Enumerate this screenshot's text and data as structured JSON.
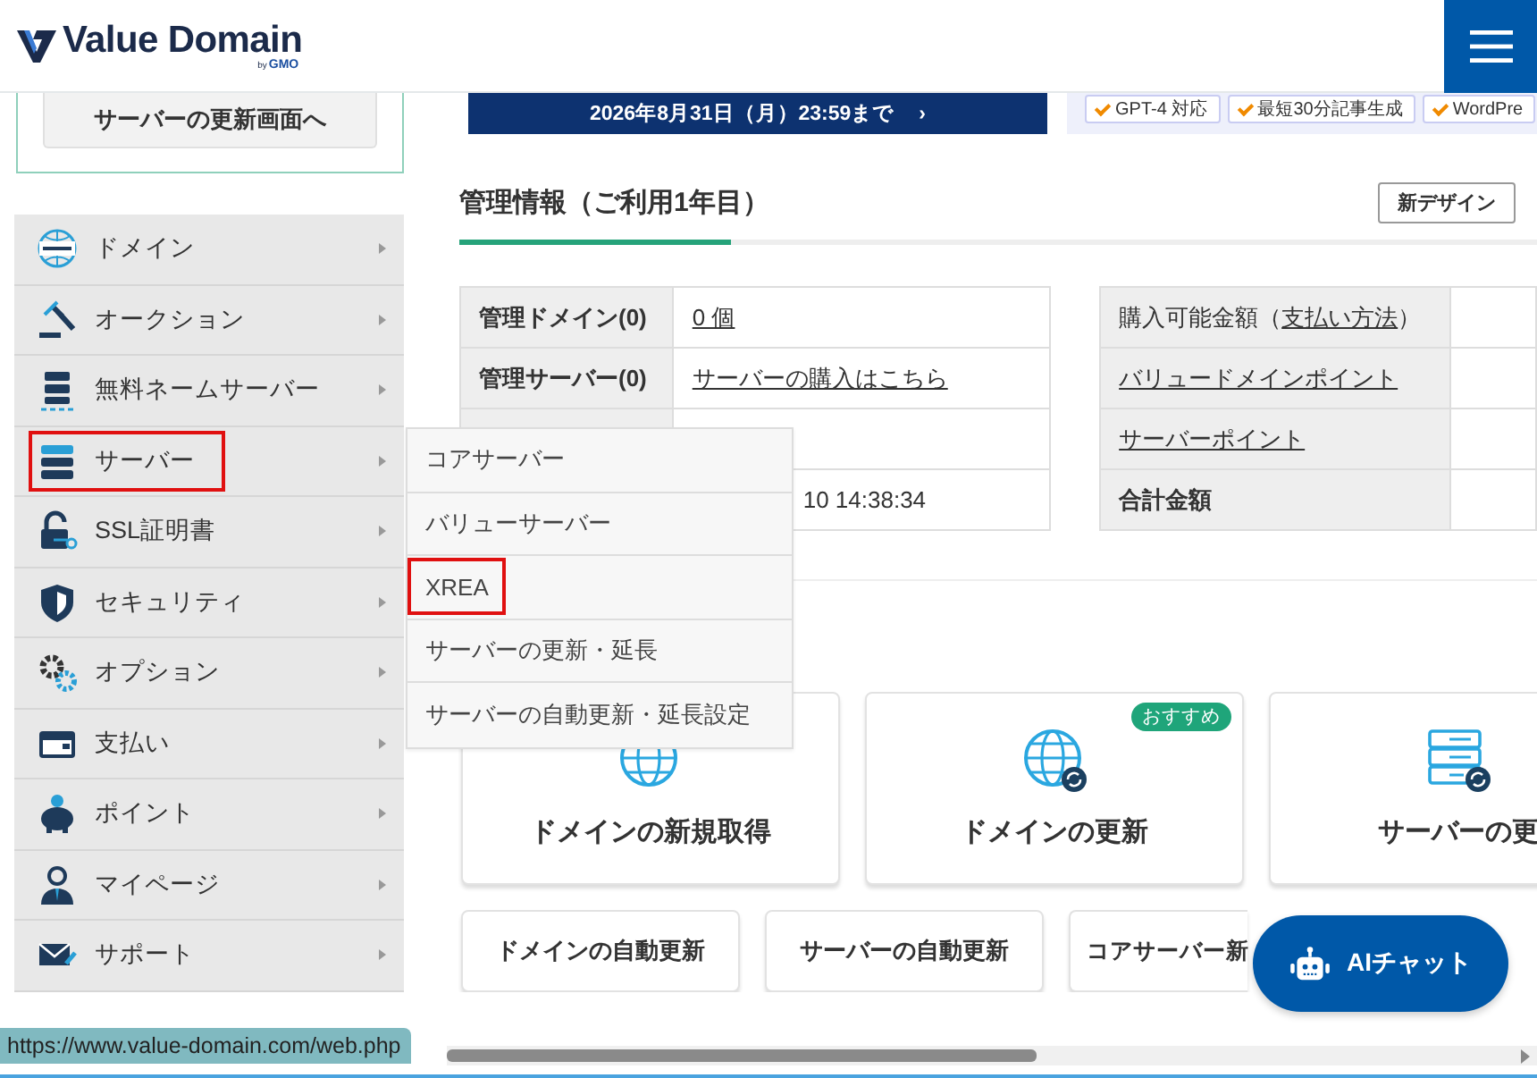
{
  "header": {
    "logo": "Value Domain",
    "logo_by": "by",
    "logo_gmo": "GMO"
  },
  "sidebar": {
    "renew_button": "サーバーの更新画面へ",
    "items": [
      {
        "label": "ドメイン",
        "highlighted": false
      },
      {
        "label": "オークション",
        "highlighted": false
      },
      {
        "label": "無料ネームサーバー",
        "highlighted": false
      },
      {
        "label": "サーバー",
        "highlighted": true
      },
      {
        "label": "SSL証明書",
        "highlighted": false
      },
      {
        "label": "セキュリティ",
        "highlighted": false
      },
      {
        "label": "オプション",
        "highlighted": false
      },
      {
        "label": "支払い",
        "highlighted": false
      },
      {
        "label": "ポイント",
        "highlighted": false
      },
      {
        "label": "マイページ",
        "highlighted": false
      },
      {
        "label": "サポート",
        "highlighted": false
      }
    ]
  },
  "flyout_menu": [
    {
      "label": "コアサーバー",
      "highlighted": false
    },
    {
      "label": "バリューサーバー",
      "highlighted": false
    },
    {
      "label": "XREA",
      "highlighted": true
    },
    {
      "label": "サーバーの更新・延長",
      "highlighted": false
    },
    {
      "label": "サーバーの自動更新・延長設定",
      "highlighted": false
    }
  ],
  "banner": {
    "text": "2026年8月31日（月）23:59まで",
    "arrow": "›"
  },
  "feature_tags": [
    "GPT-4 対応",
    "最短30分記事生成",
    "WordPre"
  ],
  "section": {
    "title": "管理情報（ご利用1年目）",
    "new_design_button": "新デザイン"
  },
  "management_table": [
    {
      "kind": "link",
      "label": "管理ドメイン(0)",
      "value": "0 個"
    },
    {
      "kind": "link",
      "label": "管理サーバー(0)",
      "value": "サーバーの購入はこちら"
    },
    {
      "kind": "covered"
    },
    {
      "kind": "partial",
      "value": "10 14:38:34"
    }
  ],
  "balance_table": [
    {
      "kind": "mixed",
      "label": "購入可能金額（",
      "link": "支払い方法",
      "label_end": "）"
    },
    {
      "kind": "link",
      "label": "バリュードメインポイント"
    },
    {
      "kind": "link",
      "label": "サーバーポイント"
    },
    {
      "kind": "bold",
      "label": "合計金額"
    }
  ],
  "action_cards": [
    {
      "label": "ドメインの新規取得",
      "kind": "globe"
    },
    {
      "label": "ドメインの更新",
      "kind": "globe-renew",
      "badge": "おすすめ"
    },
    {
      "label": "サーバーの更",
      "kind": "server-renew"
    }
  ],
  "action_buttons": [
    "ドメインの自動更新",
    "サーバーの自動更新",
    "コアサーバー新"
  ],
  "chat_button": "AIチャット",
  "status_url": "https://www.value-domain.com/web.php"
}
